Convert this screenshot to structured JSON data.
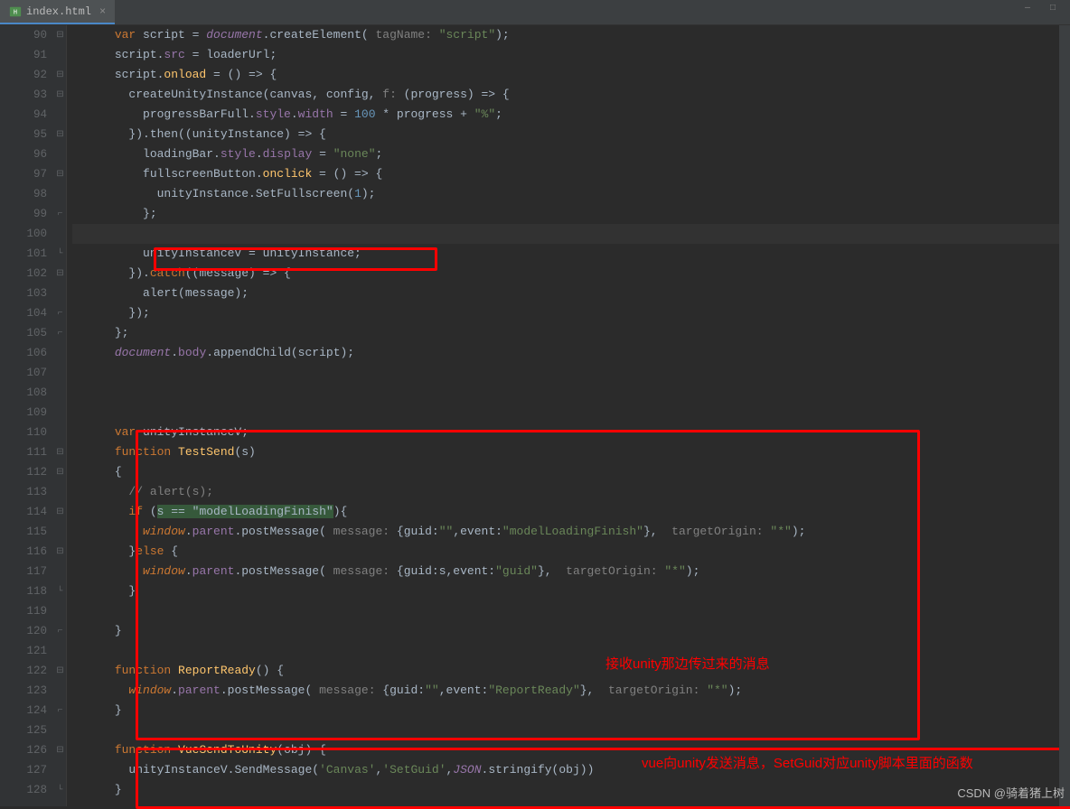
{
  "tab": {
    "filename": "index.html",
    "close_glyph": "×"
  },
  "watermark": "CSDN @骑着猪上树",
  "annotations": {
    "a1": "接收unity那边传过来的消息",
    "a2": "vue向unity发送消息，SetGuid对应unity脚本里面的函数"
  },
  "line_numbers": [
    "90",
    "91",
    "92",
    "93",
    "94",
    "95",
    "96",
    "97",
    "98",
    "99",
    "100",
    "101",
    "102",
    "103",
    "104",
    "105",
    "106",
    "107",
    "108",
    "109",
    "110",
    "111",
    "112",
    "113",
    "114",
    "115",
    "116",
    "117",
    "118",
    "119",
    "120",
    "121",
    "122",
    "123",
    "124",
    "125",
    "126",
    "127",
    "128"
  ],
  "fold_marks": {
    "0": "⊟",
    "2": "⊟",
    "3": "⊟",
    "5": "⊟",
    "7": "⊟",
    "9": "⌐",
    "11": "└",
    "12": "⊟",
    "14": "⌐",
    "15": "⌐",
    "21": "⊟",
    "22": "⊟",
    "24": "⊟",
    "26": "⊟",
    "28": "└",
    "30": "⌐",
    "32": "⊟",
    "34": "⌐",
    "36": "⊟",
    "38": "└"
  },
  "code": {
    "l90": {
      "ind": "      ",
      "a": "var",
      "b": " script = ",
      "c": "document",
      "d": ".createElement(",
      "e": " tagName:",
      "f": " \"script\"",
      "g": ");"
    },
    "l91": {
      "ind": "      ",
      "a": "script.",
      "b": "src",
      "c": " = loaderUrl;"
    },
    "l92": {
      "ind": "      ",
      "a": "script.",
      "b": "onload",
      "c": " = () => {"
    },
    "l93": {
      "ind": "        ",
      "a": "createUnityInstance(canvas, config,",
      "b": " f:",
      "c": " (progress) => {"
    },
    "l94": {
      "ind": "          ",
      "a": "progressBarFull.",
      "b": "style",
      "c": ".",
      "d": "width",
      "e": " = ",
      "f": "100",
      "g": " * progress + ",
      "h": "\"%\"",
      "i": ";"
    },
    "l95": {
      "ind": "        ",
      "a": "}).then((unityInstance) => {"
    },
    "l96": {
      "ind": "          ",
      "a": "loadingBar.",
      "b": "style",
      "c": ".",
      "d": "display",
      "e": " = ",
      "f": "\"none\"",
      "g": ";"
    },
    "l97": {
      "ind": "          ",
      "a": "fullscreenButton.",
      "b": "onclick",
      "c": " = () => {"
    },
    "l98": {
      "ind": "            ",
      "a": "unityInstance.SetFullscreen(",
      "b": "1",
      "c": ");"
    },
    "l99": {
      "ind": "          ",
      "a": "};"
    },
    "l100": {
      "ind": "          "
    },
    "l101": {
      "ind": "          ",
      "a": "unityInstanceV = unityInstance;"
    },
    "l102": {
      "ind": "        ",
      "a": "}).",
      "b": "catch",
      "c": "((message) => {"
    },
    "l103": {
      "ind": "          ",
      "a": "alert(message);"
    },
    "l104": {
      "ind": "        ",
      "a": "});"
    },
    "l105": {
      "ind": "      ",
      "a": "};"
    },
    "l106": {
      "ind": "      ",
      "a": "document",
      "b": ".",
      "c": "body",
      "d": ".appendChild(script);"
    },
    "l110": {
      "ind": "      ",
      "a": "var",
      "b": " unityInstanceV;"
    },
    "l111": {
      "ind": "      ",
      "a": "function",
      "b": " TestSend",
      "c": "(s)"
    },
    "l112": {
      "ind": "      ",
      "a": "{"
    },
    "l113": {
      "ind": "        ",
      "a": "// alert(s);"
    },
    "l114": {
      "ind": "        ",
      "a": "if",
      "b": " (",
      "c": "s == \"modelLoadingFinish\"",
      "d": "){"
    },
    "l115": {
      "ind": "          ",
      "a": "window",
      "b": ".",
      "c": "parent",
      "d": ".postMessage(",
      "e": " message:",
      "f": " {guid:",
      "g": "\"\"",
      "h": ",event:",
      "i": "\"modelLoadingFinish\"",
      "j": "},",
      "k": "  targetOrigin:",
      "l": " \"*\"",
      "m": ");"
    },
    "l116": {
      "ind": "        ",
      "a": "}",
      "b": "else",
      "c": " {"
    },
    "l117": {
      "ind": "          ",
      "a": "window",
      "b": ".",
      "c": "parent",
      "d": ".postMessage(",
      "e": " message:",
      "f": " {guid:s,event:",
      "g": "\"guid\"",
      "h": "},",
      "i": "  targetOrigin:",
      "j": " \"*\"",
      "k": ");"
    },
    "l118": {
      "ind": "        ",
      "a": "}"
    },
    "l120": {
      "ind": "      ",
      "a": "}"
    },
    "l122": {
      "ind": "      ",
      "a": "function",
      "b": " ReportReady",
      "c": "() {"
    },
    "l123": {
      "ind": "        ",
      "a": "window",
      "b": ".",
      "c": "parent",
      "d": ".postMessage(",
      "e": " message:",
      "f": " {guid:",
      "g": "\"\"",
      "h": ",event:",
      "i": "\"ReportReady\"",
      "j": "},",
      "k": "  targetOrigin:",
      "l": " \"*\"",
      "m": ");"
    },
    "l124": {
      "ind": "      ",
      "a": "}"
    },
    "l126": {
      "ind": "      ",
      "a": "function",
      "b": " VueSendToUnity",
      "c": "(obj) {"
    },
    "l127": {
      "ind": "        ",
      "a": "unityInstanceV.SendMessage(",
      "b": "'Canvas'",
      "c": ",",
      "d": "'SetGuid'",
      "e": ",",
      "f": "JSON",
      "g": ".stringify(obj))"
    },
    "l128": {
      "ind": "      ",
      "a": "}"
    }
  }
}
